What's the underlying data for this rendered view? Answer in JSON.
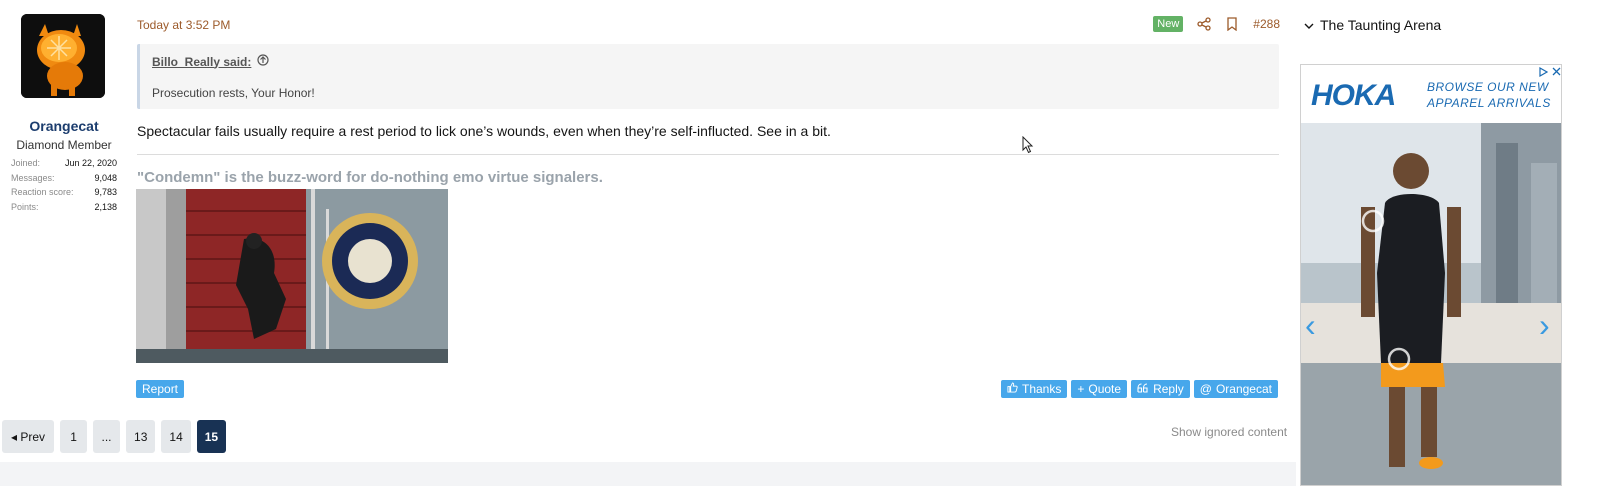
{
  "post": {
    "date": "Today at 3:52 PM",
    "new_badge": "New",
    "post_number": "#288",
    "quote": {
      "author": "Billo_Really said:",
      "text": "Prosecution rests, Your Honor!"
    },
    "body": "Spectacular fails usually require a rest period to lick one’s wounds, even when they’re self-influcted. See in a bit.",
    "signature": "\"Condemn\" is the buzz-word for do-nothing emo virtue signalers.",
    "report_label": "Report",
    "actions": {
      "thanks": "Thanks",
      "quote": "Quote",
      "reply": "Reply",
      "mention": "Orangecat"
    }
  },
  "user": {
    "name": "Orangecat",
    "title": "Diamond Member",
    "stats": [
      {
        "label": "Joined:",
        "value": "Jun 22, 2020"
      },
      {
        "label": "Messages:",
        "value": "9,048"
      },
      {
        "label": "Reaction score:",
        "value": "9,783"
      },
      {
        "label": "Points:",
        "value": "2,138"
      }
    ]
  },
  "pagination": {
    "prev": "◂ Prev",
    "pages": [
      "1",
      "...",
      "13",
      "14",
      "15"
    ],
    "current": "15",
    "show_ignored": "Show ignored content"
  },
  "sidebar": {
    "title": "The Taunting Arena"
  },
  "ad": {
    "brand": "HOKA",
    "tagline_line1": "BROWSE OUR NEW",
    "tagline_line2": "APPAREL ARRIVALS"
  },
  "colors": {
    "accent_blue": "#47a7eb",
    "new_badge_green": "#63b265",
    "active_page": "#183254",
    "username": "#1c3d6e",
    "date_brown": "#9c5a2a"
  }
}
